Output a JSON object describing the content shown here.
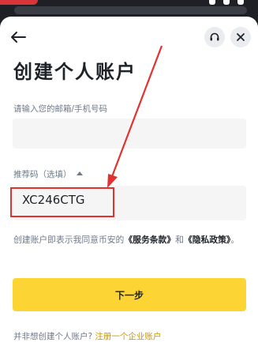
{
  "colors": {
    "accent": "#fcd535",
    "link": "#c99400",
    "annotation": "#e1322f",
    "text_primary": "#1e2329",
    "text_secondary": "#707a8a",
    "input_bg": "#f5f5f5"
  },
  "header": {
    "back_icon": "arrow-left-icon",
    "support_icon": "headset-icon",
    "close_icon": "close-icon"
  },
  "page": {
    "title": "创建个人账户"
  },
  "form": {
    "email_label": "请输入您的邮箱/手机号码",
    "email_value": "",
    "referral_label": "推荐码（选填）",
    "referral_value": "XC246CTG"
  },
  "terms": {
    "prefix": "创建账户即表示我同意币安的",
    "service_link": "《服务条款》",
    "middle": "和",
    "privacy_link": "《隐私政策》",
    "suffix": "。"
  },
  "actions": {
    "next_label": "下一步"
  },
  "footer": {
    "question": "并非想创建个人账户?",
    "link": "注册一个企业账户"
  }
}
